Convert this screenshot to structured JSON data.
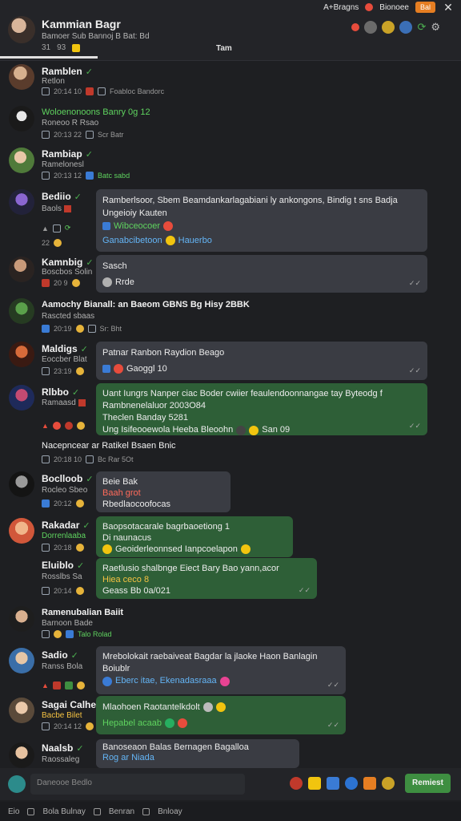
{
  "topbar": {
    "link1": "A+Bragns",
    "link2": "Bionoee",
    "badge": "Bal"
  },
  "header": {
    "name": "Kammian Bagr",
    "subtitle": "Bamoer Sub Bannoj B Bat: Bd",
    "meta1": "31",
    "meta2": "93",
    "center_label": "Tam"
  },
  "messages": [
    {
      "name": "Ramblen",
      "sub": "Retlon",
      "meta": "20:14 10",
      "meta_note": "Foabloc Bandorc"
    },
    {
      "name": "Woloenonoons Banry 0g 12",
      "sub": "Roneoo R Rsao",
      "meta": "20:13 22",
      "meta_note": "Scr Batr"
    },
    {
      "name": "Rambiap",
      "sub": "Ramelonesl",
      "meta": "20:13 12",
      "meta_note": "Batc sabd"
    },
    {
      "name": "Bediio",
      "sub": "Baols",
      "meta": "22",
      "bubble": "Ramberlsoor, Sbem Beamdankarlagabiani ly ankongons, Bindig t sns Badja",
      "bubble2": "Ungeioiy Kauten",
      "react_left": "Wibceocoer",
      "link": "Ganabcibetoon",
      "link2": "Hauerbo"
    },
    {
      "name": "Kamnbig",
      "sub": "Boscbos Solin",
      "meta": "20 9",
      "bubble": "Sasch",
      "bubble2": "Rrde"
    },
    {
      "name": "Aamochy Bianall: an Baeom GBNS Bg Hisy 2BBK",
      "sub": "Rascted sbaas",
      "meta": "20:19",
      "meta_note": "Sr: Bht"
    },
    {
      "name": "Maldigs",
      "sub": "Eoccber Blat",
      "meta": "23:19",
      "bubble": "Patnar Ranbon Raydion Beago",
      "bubble2": "Gaoggl 10"
    },
    {
      "name": "Rlbbo",
      "sub": "Ramaasd",
      "meta": "",
      "bubble": "Uant Iungrs Nanper ciac Boder cwiier feaulendoonnangae tay Byteodg f",
      "bubble2": "Rambnenelaluor 2003O84",
      "bubble3": "Theclen Banday 5281",
      "bubble4": "Ung Isifeooewola Heeba Bleoohn",
      "bubble_end": "San 09"
    },
    {
      "name": "Nacepncear ar Ratikel Bsaen Bnic",
      "sub": "",
      "meta": "20:18 10",
      "meta_note": "Bc Rar 5Ot"
    },
    {
      "name": "Boclloob",
      "sub": "Rocleo Sbeo",
      "meta": "20:12",
      "bubble": "Beie Bak",
      "bubble2": "Baah grot",
      "bubble3": "Rbedlaocoofocas"
    },
    {
      "name": "Rakadar",
      "sub": "Dorrenlaaba",
      "meta": "20:18",
      "bubble": "Baopsotacarale bagrbaoetiong 1",
      "bubble2": "Di naunacus",
      "bubble3": "Geoiderleonnsed Ianpcoelapon"
    },
    {
      "name": "Eluiblo",
      "sub": "Rosslbs Sa",
      "meta": "20:14",
      "bubble": "Raetlusio shalbnge Eiect Bary Bao yann,acor",
      "bubble2": "Hiea ceco 8",
      "bubble3": "Geass Bb 0a/021"
    },
    {
      "name": "Ramenubalian Baiit",
      "sub": "Barnoon Bade",
      "meta": "",
      "meta_note": "Talo Rolad"
    },
    {
      "name": "Sadio",
      "sub": "Ranss Bola",
      "meta": "",
      "bubble": "Mrebolokait raebaiveat Bagdar la jlaoke Haon Banlagin",
      "bubble2": "Boiublr",
      "bubble3": "Eberc itae, Ekenadasraaa"
    },
    {
      "name": "Sagai Calhe",
      "sub": "Bacbe Bilet",
      "meta": "20:14 12",
      "bubble": "Mlaohoen Raotantelkdolt",
      "bubble2": "Hepabel acaab"
    },
    {
      "name": "Naalsb",
      "sub": "Raossaleg",
      "meta": "",
      "bubble": "Banoseaon Balas Bernagen Bagalloa",
      "bubble2": "Rog ar Niada"
    }
  ],
  "composer": {
    "placeholder": "Daneooe Bedlo",
    "send": "Remiest"
  },
  "footer": {
    "item1": "Eio",
    "item2": "Bola Bulnay",
    "item3": "Benran",
    "item4": "Bnloay"
  }
}
